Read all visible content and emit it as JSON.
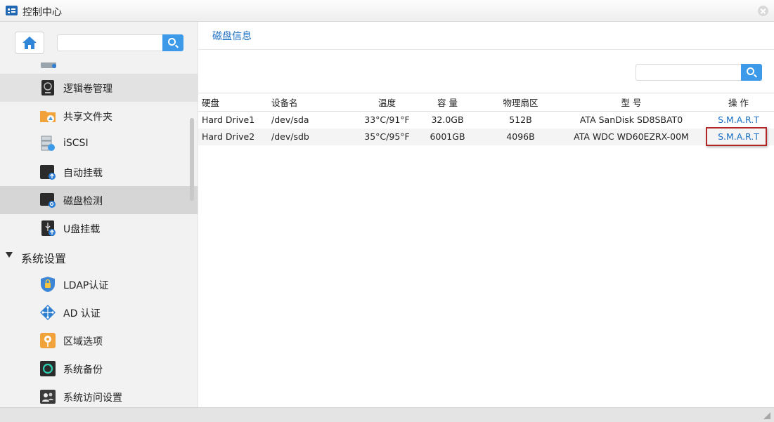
{
  "window": {
    "title": "控制中心"
  },
  "sidebar": {
    "search": {
      "value": "",
      "placeholder": ""
    },
    "items": [
      {
        "label": "逻辑卷管理",
        "icon": "logical-volume-icon"
      },
      {
        "label": "共享文件夹",
        "icon": "shared-folder-icon"
      },
      {
        "label": "iSCSI",
        "icon": "iscsi-icon"
      },
      {
        "label": "自动挂载",
        "icon": "auto-mount-icon"
      },
      {
        "label": "磁盘检测",
        "icon": "disk-check-icon"
      },
      {
        "label": "U盘挂载",
        "icon": "usb-mount-icon"
      }
    ],
    "section": {
      "label": "系统设置"
    },
    "section_items": [
      {
        "label": "LDAP认证",
        "icon": "ldap-shield-icon"
      },
      {
        "label": "AD 认证",
        "icon": "ad-network-icon"
      },
      {
        "label": "区域选项",
        "icon": "region-pin-icon"
      },
      {
        "label": "系统备份",
        "icon": "backup-icon"
      },
      {
        "label": "系统访问设置",
        "icon": "access-users-icon"
      }
    ]
  },
  "main": {
    "title": "磁盘信息",
    "search": {
      "value": "",
      "placeholder": ""
    },
    "table": {
      "headers": [
        "硬盘",
        "设备名",
        "温度",
        "容 量",
        "物理扇区",
        "型 号",
        "操 作"
      ],
      "rows": [
        {
          "name": "Hard Drive1",
          "device": "/dev/sda",
          "temp": "33°C/91°F",
          "capacity": "32.0GB",
          "sector": "512B",
          "model": "ATA SanDisk SD8SBAT0",
          "action": "S.M.A.R.T"
        },
        {
          "name": "Hard Drive2",
          "device": "/dev/sdb",
          "temp": "35°C/95°F",
          "capacity": "6001GB",
          "sector": "4096B",
          "model": "ATA WDC WD60EZRX-00M",
          "action": "S.M.A.R.T"
        }
      ]
    }
  },
  "colors": {
    "accent": "#1a6fc4",
    "search_button": "#3d9ae8",
    "highlight": "#b32626"
  }
}
